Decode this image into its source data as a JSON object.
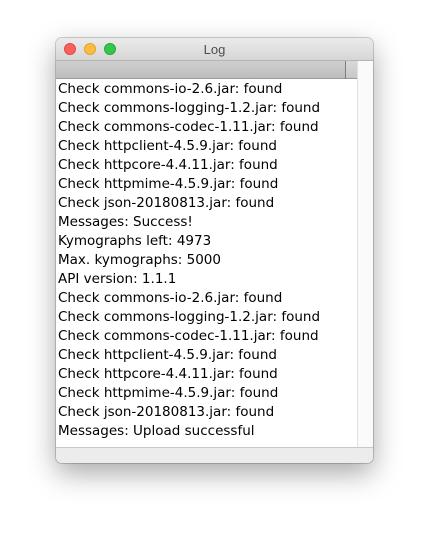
{
  "window": {
    "title": "Log"
  },
  "log": {
    "lines": [
      "Check commons-io-2.6.jar: found",
      "Check commons-logging-1.2.jar: found",
      "Check commons-codec-1.11.jar: found",
      "Check httpclient-4.5.9.jar: found",
      "Check httpcore-4.4.11.jar: found",
      "Check httpmime-4.5.9.jar: found",
      "Check json-20180813.jar: found",
      "Messages: Success!",
      "Kymographs left: 4973",
      "Max. kymographs: 5000",
      "API version: 1.1.1",
      "Check commons-io-2.6.jar: found",
      "Check commons-logging-1.2.jar: found",
      "Check commons-codec-1.11.jar: found",
      "Check httpclient-4.5.9.jar: found",
      "Check httpcore-4.4.11.jar: found",
      "Check httpmime-4.5.9.jar: found",
      "Check json-20180813.jar: found",
      "Messages: Upload successful"
    ]
  },
  "colors": {
    "close": "#fc605c",
    "minimize": "#fdbc40",
    "zoom": "#34c84a"
  }
}
